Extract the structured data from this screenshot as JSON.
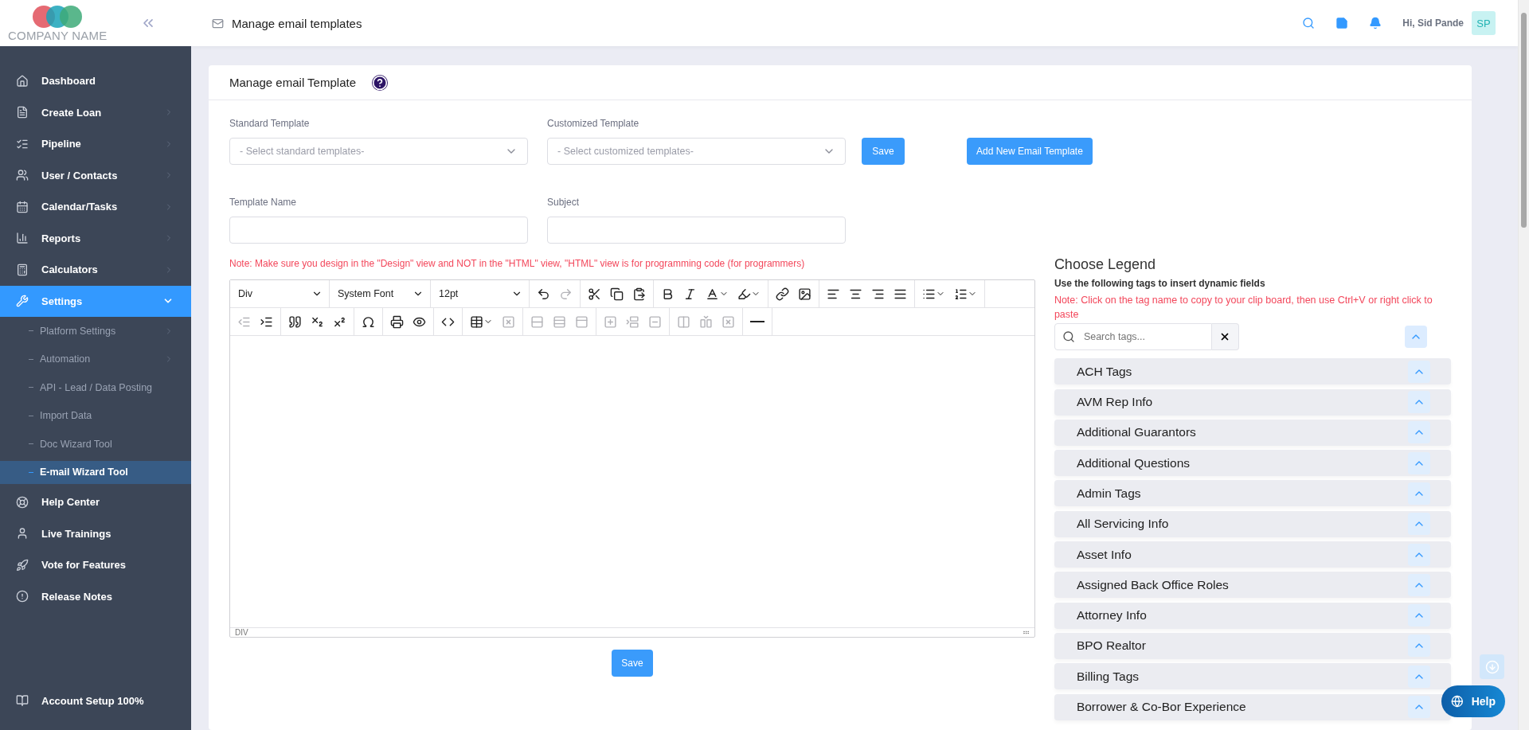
{
  "logo": {
    "text": "COMPANY NAME"
  },
  "header": {
    "title": "Manage email templates",
    "greeting": "Hi, Sid Pande",
    "avatar": "SP"
  },
  "sidebar": {
    "items": [
      {
        "label": "Dashboard",
        "selected": false,
        "expandable": false,
        "expanded": false
      },
      {
        "label": "Create Loan",
        "selected": false,
        "expandable": true,
        "expanded": false
      },
      {
        "label": "Pipeline",
        "selected": false,
        "expandable": true,
        "expanded": false
      },
      {
        "label": "User / Contacts",
        "selected": false,
        "expandable": true,
        "expanded": false
      },
      {
        "label": "Calendar/Tasks",
        "selected": false,
        "expandable": true,
        "expanded": false
      },
      {
        "label": "Reports",
        "selected": false,
        "expandable": true,
        "expanded": false
      },
      {
        "label": "Calculators",
        "selected": false,
        "expandable": true,
        "expanded": false
      },
      {
        "label": "Settings",
        "selected": true,
        "expandable": true,
        "expanded": true,
        "children": [
          {
            "label": "Platform Settings",
            "selected": false,
            "expandable": true
          },
          {
            "label": "Automation",
            "selected": false,
            "expandable": true
          },
          {
            "label": "API - Lead / Data Posting",
            "selected": false,
            "expandable": false
          },
          {
            "label": "Import Data",
            "selected": false,
            "expandable": false
          },
          {
            "label": "Doc Wizard Tool",
            "selected": false,
            "expandable": false
          },
          {
            "label": "E-mail Wizard Tool",
            "selected": true,
            "expandable": false
          }
        ]
      },
      {
        "label": "Help Center",
        "selected": false,
        "expandable": false,
        "expanded": false
      },
      {
        "label": "Live Trainings",
        "selected": false,
        "expandable": false,
        "expanded": false
      },
      {
        "label": "Vote for Features",
        "selected": false,
        "expandable": false,
        "expanded": false
      },
      {
        "label": "Release Notes",
        "selected": false,
        "expandable": false,
        "expanded": false
      }
    ],
    "footer": "Account Setup 100%"
  },
  "card": {
    "title": "Manage email Template",
    "standard_template": {
      "label": "Standard Template",
      "placeholder": "- Select standard templates-"
    },
    "customized_template": {
      "label": "Customized Template",
      "placeholder": "- Select customized templates-"
    },
    "save_top": "Save",
    "add_button": "Add New Email Template",
    "template_name": {
      "label": "Template Name"
    },
    "subject": {
      "label": "Subject"
    },
    "note": "Note: Make sure you design in the \"Design\" view and NOT in the \"HTML\" view, \"HTML\" view is for programming code (for programmers)",
    "editor": {
      "block_format": "Div",
      "font": "System Font",
      "size": "12pt",
      "status": "DIV",
      "rows": [
        [
          [
            {
              "disabled": false
            },
            {
              "disabled": true
            }
          ],
          [
            {
              "disabled": false
            },
            {
              "disabled": false
            },
            {
              "disabled": false
            }
          ],
          [
            {
              "disabled": false
            },
            {
              "disabled": false
            },
            {
              "disabled": false
            },
            {
              "disabled": false
            }
          ],
          [
            {
              "disabled": false
            },
            {
              "disabled": false
            }
          ],
          [
            {
              "disabled": false
            },
            {
              "disabled": false
            },
            {
              "disabled": false
            },
            {
              "disabled": false
            }
          ],
          [
            {
              "disabled": false
            },
            {
              "disabled": false
            }
          ]
        ],
        [
          [
            {
              "disabled": true
            },
            {
              "disabled": false
            }
          ],
          [
            {
              "disabled": false
            },
            {
              "disabled": false
            },
            {
              "disabled": false
            }
          ],
          [
            {
              "disabled": false
            }
          ],
          [
            {
              "disabled": false
            },
            {
              "disabled": false
            }
          ],
          [
            {
              "disabled": false
            }
          ],
          [
            {
              "disabled": false
            },
            {
              "disabled": true
            }
          ],
          [
            {
              "disabled": true
            },
            {
              "disabled": true
            },
            {
              "disabled": true
            }
          ],
          [
            {
              "disabled": true
            },
            {
              "disabled": true
            },
            {
              "disabled": true
            }
          ],
          [
            {
              "disabled": true
            },
            {
              "disabled": true
            },
            {
              "disabled": true
            }
          ],
          [
            {
              "disabled": false
            }
          ]
        ]
      ]
    },
    "save_bottom": "Save"
  },
  "legend": {
    "title": "Choose Legend",
    "subtitle": "Use the following tags to insert dynamic fields",
    "note": "Note: Click on the tag name to copy to your clip board, then use Ctrl+V or right click to paste",
    "search_placeholder": "Search tags...",
    "groups": [
      "ACH Tags",
      "AVM Rep Info",
      "Additional Guarantors",
      "Additional Questions",
      "Admin Tags",
      "All Servicing Info",
      "Asset Info",
      "Assigned Back Office Roles",
      "Attorney Info",
      "BPO Realtor",
      "Billing Tags",
      "Borrower & Co-Bor Experience"
    ]
  },
  "help_button": "Help"
}
